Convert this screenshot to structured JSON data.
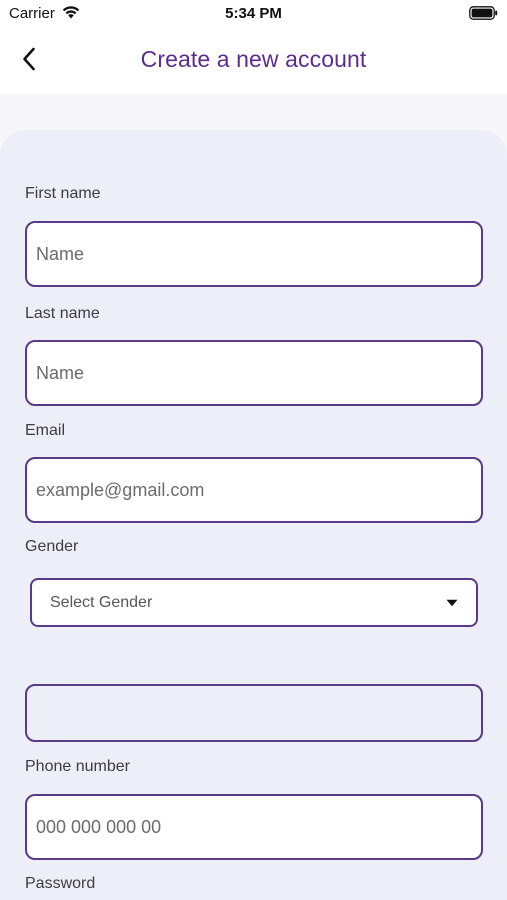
{
  "status_bar": {
    "carrier": "Carrier",
    "time": "5:34 PM",
    "icons": [
      "wifi-icon",
      "battery-icon"
    ]
  },
  "nav": {
    "back_icon": "chevron-left-icon",
    "title": "Create a new account"
  },
  "form": {
    "first_name": {
      "label": "First name",
      "placeholder": "Name"
    },
    "last_name": {
      "label": "Last name",
      "placeholder": "Name"
    },
    "email": {
      "label": "Email",
      "placeholder": "example@gmail.com"
    },
    "gender": {
      "label": "Gender",
      "selected": "Select Gender",
      "icon": "caret-down-icon"
    },
    "extra_field": {
      "value": ""
    },
    "phone": {
      "label": "Phone number",
      "placeholder": "000 000 000 00"
    },
    "password": {
      "label": "Password"
    }
  },
  "colors": {
    "accent": "#5b2d8e",
    "border": "#5a3a86",
    "card_background": "#eceef8"
  }
}
